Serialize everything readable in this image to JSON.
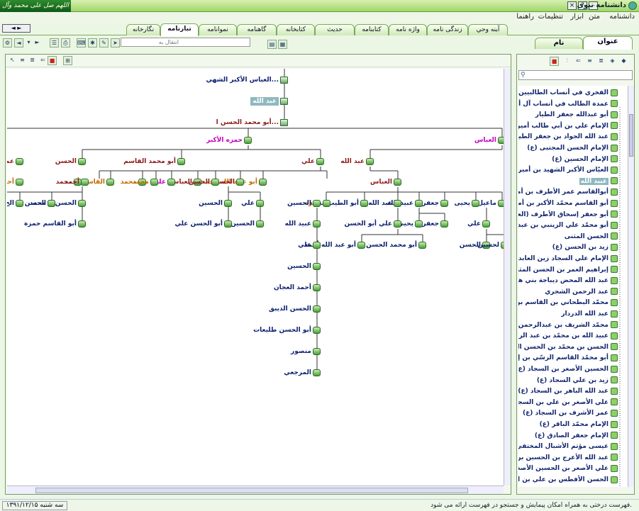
{
  "window": {
    "title": "دانشنامه نبوی",
    "banner_text": "اللهم صل على محمد وآل محمد",
    "nav_buttons": "◄ ►"
  },
  "menu": [
    "دانشنامه",
    "متن",
    "ابزار",
    "تنظیمات",
    "راهنما"
  ],
  "main_tabs": [
    {
      "label": "آينه وحي",
      "active": false
    },
    {
      "label": "زندگی نامه",
      "active": false
    },
    {
      "label": "واژه نامه",
      "active": false
    },
    {
      "label": "کتابنامه",
      "active": false
    },
    {
      "label": "حديث",
      "active": false
    },
    {
      "label": "کتابخانه",
      "active": false
    },
    {
      "label": "گاهنامه",
      "active": false
    },
    {
      "label": "نموانامه",
      "active": false
    },
    {
      "label": "تبارنامه",
      "active": true
    },
    {
      "label": "نگارخانه",
      "active": false
    }
  ],
  "toolbar": {
    "goto_placeholder": "انتقال به"
  },
  "side_tabs": [
    {
      "label": "عنوان",
      "active": true
    },
    {
      "label": "نام",
      "active": false
    }
  ],
  "tree_nodes": [
    {
      "label": "العباس الأكبر الشهي...",
      "color": "navy"
    },
    {
      "label": "عبد الله",
      "color": "sel"
    },
    {
      "label": "أبو محمد الحسن ا...",
      "color": "maroon"
    },
    {
      "label": "العباس",
      "color": "magenta"
    },
    {
      "label": "حمزه الأكبر",
      "color": "magenta"
    },
    {
      "label": "الحسن",
      "color": "maroon"
    },
    {
      "label": "عبد الله",
      "color": "maroon"
    },
    {
      "label": "علي",
      "color": "maroon"
    },
    {
      "label": "أبو محمد القاسم",
      "color": "maroon"
    },
    {
      "label": "محمد",
      "color": "maroon"
    },
    {
      "label": "محمد",
      "color": "orange"
    },
    {
      "label": "العباس",
      "color": "maroon"
    },
    {
      "label": "ماعيل",
      "color": "navy"
    },
    {
      "label": "يحيى",
      "color": "navy"
    },
    {
      "label": "جعفر",
      "color": "navy"
    },
    {
      "label": "عبيد الله",
      "color": "navy"
    },
    {
      "label": "عبد الله",
      "color": "navy"
    },
    {
      "label": "أبو الطيب محمد",
      "color": "navy"
    },
    {
      "label": "حمزه",
      "color": "orange"
    },
    {
      "label": "أبو عبيد الله محمد",
      "color": "orange"
    },
    {
      "label": "الحسين",
      "color": "maroon"
    },
    {
      "label": "الحسن",
      "color": "maroon"
    },
    {
      "label": "العباس",
      "color": "maroon"
    },
    {
      "label": "علي",
      "color": "magenta"
    },
    {
      "label": "محمد",
      "color": "orange"
    },
    {
      "label": "القاسم",
      "color": "orange"
    },
    {
      "label": "أحمد",
      "color": "maroon"
    },
    {
      "label": "أحمد",
      "color": "orange"
    },
    {
      "label": "محمد",
      "color": "navy"
    },
    {
      "label": "الحسن",
      "color": "navy"
    },
    {
      "label": "الح",
      "color": "navy"
    },
    {
      "label": "علي",
      "color": "navy"
    },
    {
      "label": "جعفر",
      "color": "navy"
    },
    {
      "label": "يحيى",
      "color": "navy"
    },
    {
      "label": "علي أبو الحسن",
      "color": "navy"
    },
    {
      "label": "الحسين",
      "color": "navy"
    },
    {
      "label": "علي",
      "color": "navy"
    },
    {
      "label": "الحسين",
      "color": "navy"
    },
    {
      "label": "أبو الحسن علي",
      "color": "navy"
    },
    {
      "label": "الحسن",
      "color": "navy"
    },
    {
      "label": "أبو القاسم حمزة",
      "color": "navy"
    },
    {
      "label": "الحسين",
      "color": "navy"
    },
    {
      "label": "أبو محمد الحسن",
      "color": "navy"
    },
    {
      "label": "أبو عبد الله أحمد",
      "color": "navy"
    },
    {
      "label": "عبيد الله",
      "color": "navy"
    },
    {
      "label": "علي",
      "color": "navy"
    },
    {
      "label": "الحسين",
      "color": "navy"
    },
    {
      "label": "أحمد العجان",
      "color": "navy"
    },
    {
      "label": "الحسن الديبق",
      "color": "navy"
    },
    {
      "label": "أبو الحسن طليعات",
      "color": "navy"
    },
    {
      "label": "منصور",
      "color": "navy"
    },
    {
      "label": "المرجعي",
      "color": "navy"
    },
    {
      "label": "الحسن",
      "color": "navy"
    },
    {
      "label": "لحسين",
      "color": "navy"
    },
    {
      "label": "عمد",
      "color": "maroon"
    },
    {
      "label": "أحمد",
      "color": "orange"
    },
    {
      "label": "الحسن",
      "color": "navy"
    }
  ],
  "side_list": [
    {
      "label": "الفخري في أنساب الطالبيين",
      "selected": false
    },
    {
      "label": "عمدة الطالب في أنساب آل أبي طالب",
      "selected": false
    },
    {
      "label": "أبو عبدالله جعفر الطيار",
      "selected": false
    },
    {
      "label": "الإمام علي بن أبي طالب أمير المؤمنين",
      "selected": false
    },
    {
      "label": "عبد الله الجواد بن جعفر الطيار",
      "selected": false
    },
    {
      "label": "الإمام الحسن المجتبى (ع)",
      "selected": false
    },
    {
      "label": "الإمام الحسين (ع)",
      "selected": false
    },
    {
      "label": "العبّاس الأكبر الشهيد بن أميرالمؤمنين",
      "selected": false
    },
    {
      "label": "عبيد الله",
      "selected": true
    },
    {
      "label": "أبوالقاسم عمر الأطرف بن أميرالمؤمنين",
      "selected": false
    },
    {
      "label": "أبو القاسم محمّد الأكبر بن أميرالمؤمنين",
      "selected": false
    },
    {
      "label": "أبو جعفر إسحاق الأطرف (العريضي)",
      "selected": false
    },
    {
      "label": "أبو محمّد علي الزينبي بن عبدالله بن",
      "selected": false
    },
    {
      "label": "الحسن المثنى",
      "selected": false
    },
    {
      "label": "زيد بن الحسن (ع)",
      "selected": false
    },
    {
      "label": "الإمام علي السجاد زين العابدين (ع)",
      "selected": false
    },
    {
      "label": "إبراهيم الغمر بن الحسن المثنى",
      "selected": false
    },
    {
      "label": "عبد الله المحض ديباجة بني هاشم بن",
      "selected": false
    },
    {
      "label": "عبد الرحمن الشجري",
      "selected": false
    },
    {
      "label": "محمّد البطحاني بن القاسم بن الحسن",
      "selected": false
    },
    {
      "label": "عبد الله الدردار",
      "selected": false
    },
    {
      "label": "محمّد الشريف بن عبدالرحمن الشجري",
      "selected": false
    },
    {
      "label": "عبيد الله بن محمّد بن عبد الرحمن",
      "selected": false
    },
    {
      "label": "الحسن بن محمّد بن الحسن المثنى",
      "selected": false
    },
    {
      "label": "أبو محمّد القاسم الرسّي بن إبراهيم",
      "selected": false
    },
    {
      "label": "الحسين الأصغر بن السجاد (ع)",
      "selected": false
    },
    {
      "label": "زيد بن علي السجاد (ع)",
      "selected": false
    },
    {
      "label": "عبد الله الباهر بن السجاد (ع)",
      "selected": false
    },
    {
      "label": "علي الأصغر بن علي بن السجاد (ع)",
      "selected": false
    },
    {
      "label": "عمر الأشرف بن السجاد (ع)",
      "selected": false
    },
    {
      "label": "الإمام محمّد الباقر (ع)",
      "selected": false
    },
    {
      "label": "الإمام جعفر الصادق (ع)",
      "selected": false
    },
    {
      "label": "عيسى مؤتم الأشبال المختفي بن زيد",
      "selected": false
    },
    {
      "label": "عبد الله الأعرج بن الحسين بن السجاد",
      "selected": false
    },
    {
      "label": "علي الأصغر بن الحسين الأصغر بن",
      "selected": false
    },
    {
      "label": "الحسن الأفطس بن علي بن السجاد",
      "selected": false
    }
  ],
  "status": {
    "message": "فهرست درختی به همراه امکان پیمایش و جستجو در فهرست ارائه می شود.",
    "date": "سه شنبه ۱۳۹۱/۱۲/۱۵"
  }
}
